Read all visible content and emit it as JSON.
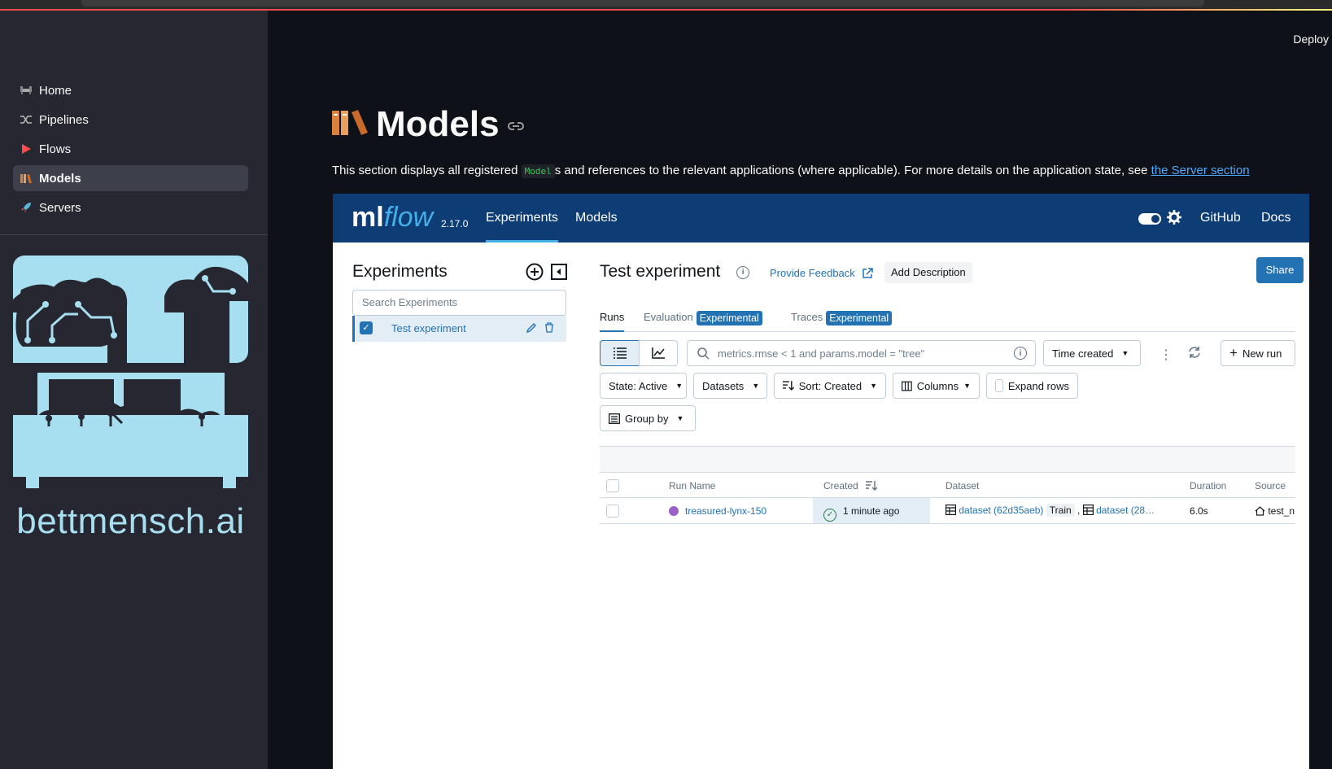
{
  "sidebar": {
    "items": [
      {
        "label": "Home",
        "icon": "couch-icon"
      },
      {
        "label": "Pipelines",
        "icon": "shuffle-icon"
      },
      {
        "label": "Flows",
        "icon": "play-icon"
      },
      {
        "label": "Models",
        "icon": "books-icon"
      },
      {
        "label": "Servers",
        "icon": "rocket-icon"
      }
    ],
    "active_index": 3,
    "logo_text": "bettmensch.ai"
  },
  "header": {
    "deploy_label": "Deploy"
  },
  "page": {
    "title": "Models",
    "description_before": "This section displays all registered ",
    "description_code": "Model",
    "description_after": "s and references to the relevant applications (where applicable). For more details on the application state, see ",
    "description_link": "the Server section"
  },
  "mlflow": {
    "logo_ml": "ml",
    "logo_flow": "flow",
    "version": "2.17.0",
    "nav": [
      "Experiments",
      "Models"
    ],
    "nav_active": "Experiments",
    "github": "GitHub",
    "docs": "Docs",
    "colors": {
      "header_bg": "#0e3c74",
      "accent": "#2272b4",
      "logo_flow": "#43b0e8"
    },
    "experiments_panel": {
      "title": "Experiments",
      "search_placeholder": "Search Experiments",
      "items": [
        {
          "name": "Test experiment",
          "checked": true
        }
      ]
    },
    "experiment": {
      "name": "Test experiment",
      "feedback": "Provide Feedback",
      "add_description": "Add Description",
      "share": "Share",
      "tabs": [
        {
          "label": "Runs",
          "badge": ""
        },
        {
          "label": "Evaluation",
          "badge": "Experimental"
        },
        {
          "label": "Traces",
          "badge": "Experimental"
        }
      ],
      "search_placeholder": "metrics.rmse < 1 and params.model = \"tree\"",
      "time_filter": "Time created",
      "new_run": "New run",
      "filters": {
        "state": "State: Active",
        "datasets": "Datasets",
        "sort": "Sort: Created",
        "columns": "Columns",
        "expand_rows": "Expand rows",
        "group_by": "Group by"
      },
      "table": {
        "columns": [
          "Run Name",
          "Created",
          "Dataset",
          "Duration",
          "Source"
        ],
        "rows": [
          {
            "run_name": "treasured-lynx-150",
            "created": "1 minute ago",
            "dataset_1": "dataset (62d35aeb)",
            "dataset_1_tag": "Train",
            "separator": ",",
            "dataset_2": "dataset (28…",
            "duration": "6.0s",
            "source": "test_n"
          }
        ]
      }
    }
  }
}
